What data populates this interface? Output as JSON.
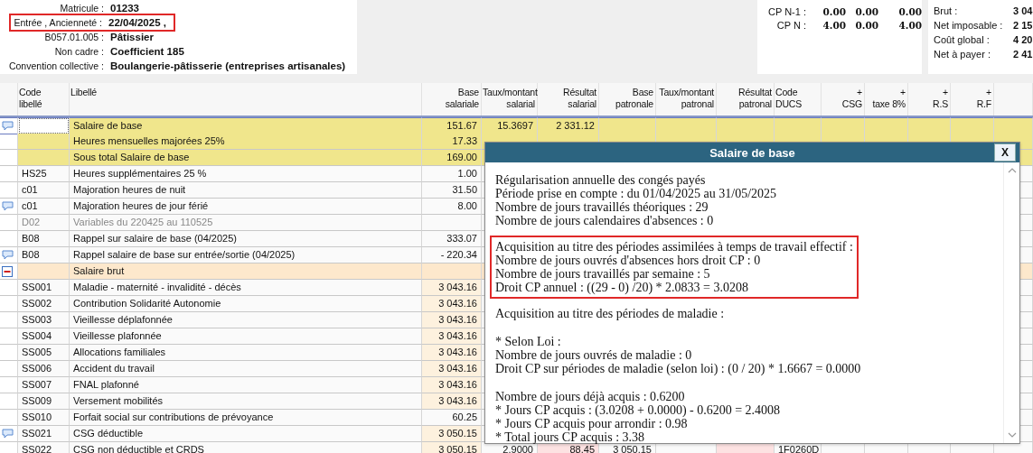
{
  "employee": {
    "fields": [
      {
        "label": "Matricule :",
        "value": "01233",
        "highlighted": false
      },
      {
        "label": "Entrée , Ancienneté :",
        "value": "22/04/2025 ,",
        "highlighted": true
      },
      {
        "label": "B057.01.005 :",
        "value": "Pâtissier",
        "highlighted": false
      },
      {
        "label": "Non cadre :",
        "value": "Coefficient 185",
        "highlighted": false
      },
      {
        "label": "Convention collective :",
        "value": "Boulangerie-pâtisserie (entreprises artisanales)",
        "highlighted": false
      }
    ]
  },
  "leave_balances": [
    {
      "label": "CP N-1 :",
      "values": [
        "0.00",
        "0.00",
        "0.00"
      ]
    },
    {
      "label": "CP N :",
      "values": [
        "4.00",
        "0.00",
        "4.00"
      ]
    }
  ],
  "totals": [
    {
      "label": "Brut :",
      "value": "3 04"
    },
    {
      "label": "Net imposable :",
      "value": "2 15"
    },
    {
      "label": "Coût global :",
      "value": "4 20"
    },
    {
      "label": "Net à payer :",
      "value": "2 41"
    }
  ],
  "table": {
    "columns": [
      "Code\nlibellé",
      "Libellé",
      "Base\nsalariale",
      "Taux/montant\nsalarial",
      "Résultat\nsalarial",
      "Base\npatronale",
      "Taux/montant\npatronal",
      "Résultat\npatronal",
      "Code\nDUCS",
      "+\nCSG",
      "+\ntaxe 8%",
      "+\nR.S",
      "+\nR.F"
    ],
    "rows": [
      {
        "comment": true,
        "code": "",
        "label": "Salaire de base",
        "kind": "base",
        "selected": true,
        "values": [
          "151.67",
          "15.3697",
          "2 331.12"
        ]
      },
      {
        "comment": false,
        "code": "",
        "label": "Heures mensuelles majorées 25%",
        "kind": "base",
        "selected": false,
        "values": [
          "17.33"
        ]
      },
      {
        "comment": false,
        "code": "",
        "label": "Sous total Salaire de base",
        "kind": "base",
        "selected": false,
        "values": [
          "169.00"
        ]
      },
      {
        "comment": false,
        "code": "HS25",
        "label": "Heures supplémentaires 25 %",
        "kind": "normal",
        "selected": false,
        "values": [
          "1.00"
        ]
      },
      {
        "comment": false,
        "code": "c01",
        "label": "Majoration heures de nuit",
        "kind": "normal",
        "selected": false,
        "values": [
          "31.50"
        ]
      },
      {
        "comment": true,
        "code": "c01",
        "label": "Majoration heures de jour férié",
        "kind": "normal",
        "selected": false,
        "values": [
          "8.00"
        ]
      },
      {
        "comment": false,
        "code": "D02",
        "label": "Variables du 220425 au 110525",
        "kind": "muted",
        "selected": false,
        "values": []
      },
      {
        "comment": false,
        "code": "B08",
        "label": "Rappel sur salaire de base (04/2025)",
        "kind": "normal",
        "selected": false,
        "values": [
          "333.07"
        ]
      },
      {
        "comment": true,
        "code": "B08",
        "label": "Rappel salaire de base sur entrée/sortie (04/2025)",
        "kind": "normal",
        "selected": false,
        "values": [
          "- 220.34"
        ]
      },
      {
        "comment": false,
        "code": "",
        "label": "Salaire brut",
        "kind": "total",
        "selected": false,
        "values": []
      },
      {
        "comment": false,
        "code": "SS001",
        "label": "Maladie - maternité - invalidité - décès",
        "kind": "cotisation",
        "selected": false,
        "values": [
          "3 043.16"
        ]
      },
      {
        "comment": false,
        "code": "SS002",
        "label": "Contribution Solidarité Autonomie",
        "kind": "cotisation",
        "selected": false,
        "values": [
          "3 043.16"
        ]
      },
      {
        "comment": false,
        "code": "SS003",
        "label": "Vieillesse déplafonnée",
        "kind": "cotisation",
        "selected": false,
        "values": [
          "3 043.16"
        ]
      },
      {
        "comment": false,
        "code": "SS004",
        "label": "Vieillesse plafonnée",
        "kind": "cotisation",
        "selected": false,
        "values": [
          "3 043.16"
        ]
      },
      {
        "comment": false,
        "code": "SS005",
        "label": "Allocations familiales",
        "kind": "cotisation",
        "selected": false,
        "values": [
          "3 043.16"
        ]
      },
      {
        "comment": false,
        "code": "SS006",
        "label": "Accident du travail",
        "kind": "cotisation",
        "selected": false,
        "values": [
          "3 043.16"
        ]
      },
      {
        "comment": false,
        "code": "SS007",
        "label": "FNAL plafonné",
        "kind": "cotisation",
        "selected": false,
        "values": [
          "3 043.16"
        ]
      },
      {
        "comment": false,
        "code": "SS009",
        "label": "Versement mobilités",
        "kind": "cotisation",
        "selected": false,
        "values": [
          "3 043.16"
        ]
      },
      {
        "comment": false,
        "code": "SS010",
        "label": "Forfait social sur contributions de prévoyance",
        "kind": "normal",
        "selected": false,
        "values": [
          "60.25"
        ]
      },
      {
        "comment": true,
        "code": "SS021",
        "label": "CSG déductible",
        "kind": "cotisation",
        "selected": false,
        "values": [
          "3 050.15"
        ]
      },
      {
        "comment": false,
        "code": "SS022",
        "label": "CSG non déductible et CRDS",
        "kind": "cotisation",
        "selected": false,
        "values": [
          "3 050.15",
          "2.9000",
          "88.45",
          "3 050.15"
        ],
        "code_ducs": "1F0260D"
      }
    ]
  },
  "dialog": {
    "title": "Salaire de base",
    "close": "X",
    "groups": [
      {
        "highlighted": false,
        "lines": [
          "Régularisation annuelle des congés payés",
          "Période prise en compte : du 01/04/2025 au 31/05/2025",
          "Nombre de jours travaillés théoriques : 29",
          "Nombre de jours calendaires d'absences : 0"
        ]
      },
      {
        "highlighted": true,
        "lines": [
          "Acquisition au titre des périodes assimilées à temps de travail effectif :",
          "Nombre de jours ouvrés d'absences hors droit CP : 0",
          "Nombre de jours travaillés par semaine : 5",
          "Droit CP annuel : ((29 - 0) /20) * 2.0833 = 3.0208"
        ]
      },
      {
        "highlighted": false,
        "lines": [
          "Acquisition au titre des périodes de maladie :"
        ]
      },
      {
        "highlighted": false,
        "lines": [
          "* Selon Loi :",
          "Nombre de jours ouvrés de maladie : 0",
          "Droit CP sur périodes de maladie (selon loi) : (0 / 20) * 1.6667 = 0.0000"
        ]
      },
      {
        "highlighted": false,
        "lines": [
          "Nombre de jours déjà acquis : 0.6200",
          "* Jours CP acquis : (3.0208 + 0.0000) - 0.6200 = 2.4008",
          "* Jours CP acquis pour arrondir : 0.98",
          "* Total jours CP acquis : 3.38"
        ]
      }
    ]
  }
}
